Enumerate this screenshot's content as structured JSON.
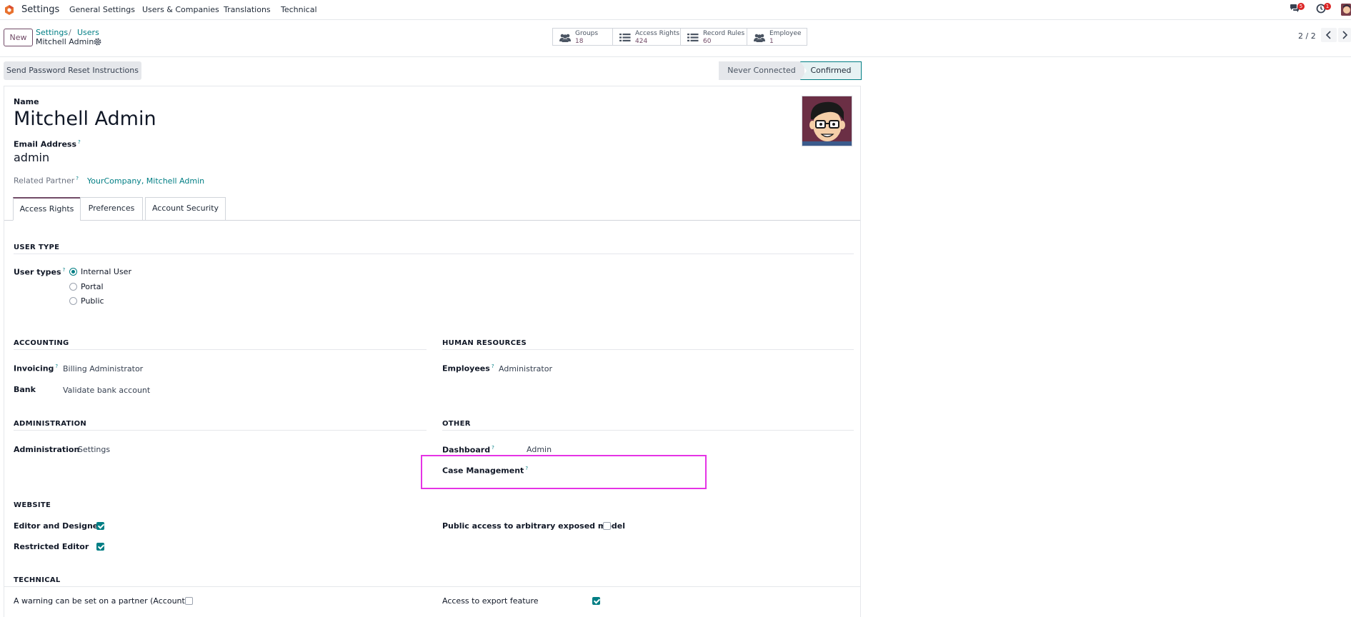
{
  "topnav": {
    "app_name": "Settings",
    "menu": [
      "General Settings",
      "Users & Companies",
      "Translations",
      "Technical"
    ],
    "messages_badge": "5",
    "activity_badge": "1"
  },
  "control_panel": {
    "new_label": "New",
    "breadcrumb": [
      "Settings",
      "Users"
    ],
    "breadcrumb_sep": "/",
    "record_name": "Mitchell Admin",
    "smart_buttons": [
      {
        "label": "Groups",
        "count": "18"
      },
      {
        "label": "Access Rights",
        "count": "424"
      },
      {
        "label": "Record Rules",
        "count": "60"
      },
      {
        "label": "Employee",
        "count": "1"
      }
    ],
    "pager": "2 / 2"
  },
  "status": {
    "reset_button": "Send Password Reset Instructions",
    "stages": [
      "Never Connected",
      "Confirmed"
    ],
    "current_stage": "Confirmed"
  },
  "form": {
    "name_label": "Name",
    "name_value": "Mitchell Admin",
    "email_label": "Email Address",
    "email_value": "admin",
    "partner_label": "Related Partner",
    "partner_value": "YourCompany, Mitchell Admin",
    "help_mark": "?",
    "tabs": [
      "Access Rights",
      "Preferences",
      "Account Security"
    ],
    "user_type": {
      "section": "USER TYPE",
      "label": "User types",
      "options": [
        "Internal User",
        "Portal",
        "Public"
      ],
      "selected": "Internal User"
    },
    "accounting": {
      "section": "ACCOUNTING",
      "invoicing_label": "Invoicing",
      "invoicing_value": "Billing Administrator",
      "bank_label": "Bank",
      "bank_value": "Validate bank account"
    },
    "human_resources": {
      "section": "HUMAN RESOURCES",
      "employees_label": "Employees",
      "employees_value": "Administrator"
    },
    "administration": {
      "section": "ADMINISTRATION",
      "label": "Administration",
      "value": "Settings"
    },
    "other": {
      "section": "OTHER",
      "dashboard_label": "Dashboard",
      "dashboard_value": "Admin",
      "case_label": "Case Management"
    },
    "website": {
      "section": "WEBSITE",
      "editor_label": "Editor and Designer",
      "editor_checked": true,
      "restricted_label": "Restricted Editor",
      "restricted_checked": true,
      "public_label": "Public access to arbitrary exposed model",
      "public_checked": false
    },
    "technical": {
      "section": "TECHNICAL",
      "warning_label": "A warning can be set on a partner (Account)",
      "warning_checked": false,
      "export_label": "Access to export feature",
      "export_checked": true
    }
  },
  "colors": {
    "brand": "#714b67",
    "accent": "#017e84",
    "highlight": "#e534e5"
  }
}
